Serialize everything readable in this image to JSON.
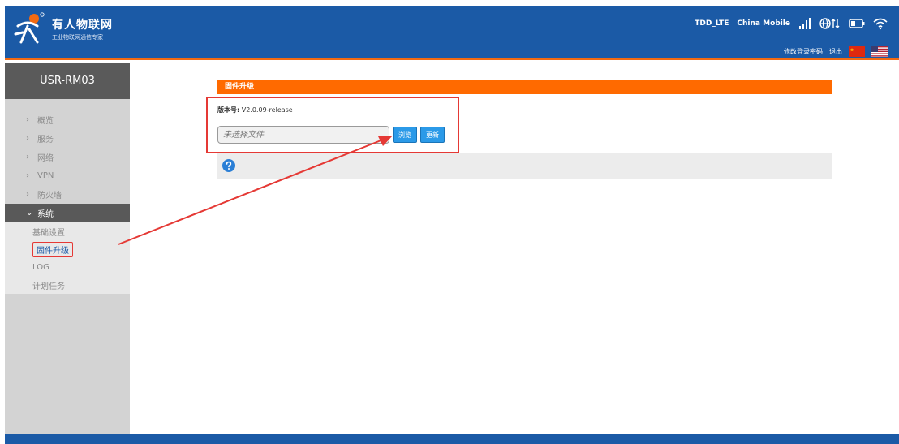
{
  "header": {
    "brand_name": "有人物联网",
    "brand_slogan": "工业物联网通信专家",
    "network_type": "TDD_LTE",
    "carrier": "China Mobile",
    "change_password": "修改登录密码",
    "logout": "退出"
  },
  "sidebar": {
    "device_title": "USR-RM03",
    "items": [
      {
        "label": "概览"
      },
      {
        "label": "服务"
      },
      {
        "label": "网络"
      },
      {
        "label": "VPN"
      },
      {
        "label": "防火墙"
      },
      {
        "label": "系统"
      }
    ],
    "system_subitems": [
      {
        "label": "基础设置"
      },
      {
        "label": "固件升级"
      },
      {
        "label": "LOG"
      },
      {
        "label": "计划任务"
      }
    ]
  },
  "main": {
    "section_title": "固件升级",
    "version_label": "版本号:",
    "version_value": "V2.0.09-release",
    "file_placeholder": "未选择文件",
    "browse_label": "浏览",
    "update_label": "更新"
  },
  "colors": {
    "header_blue": "#1b5aa6",
    "accent_orange": "#ff6a00",
    "annotation_red": "#e53935",
    "button_blue": "#2b9ae8"
  }
}
